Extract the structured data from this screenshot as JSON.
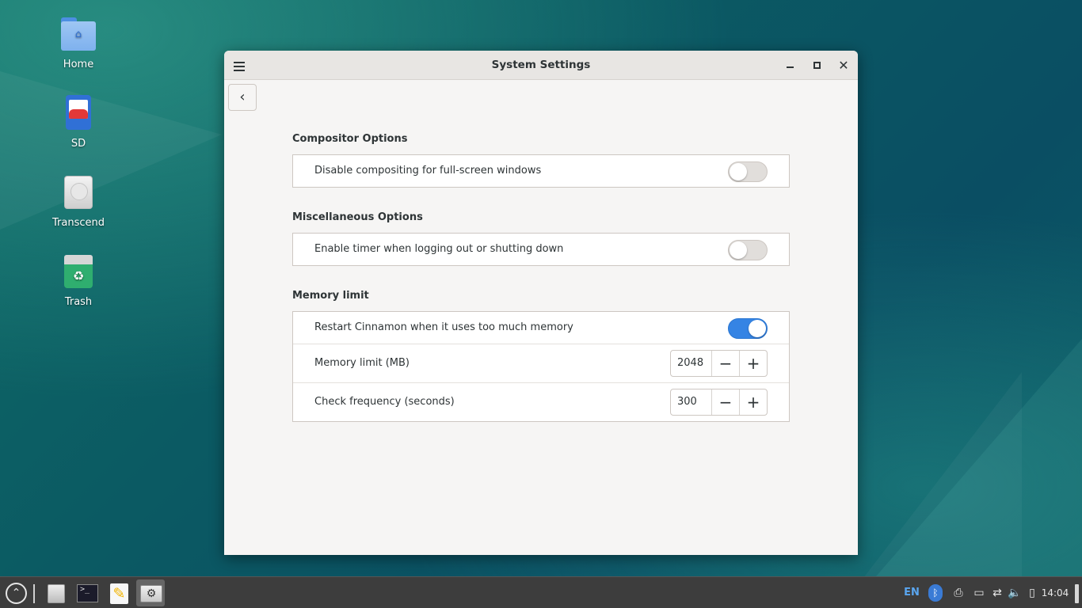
{
  "desktop": {
    "icons": [
      {
        "label": "Home",
        "icon": "home-folder-icon"
      },
      {
        "label": "SD",
        "icon": "sd-card-icon"
      },
      {
        "label": "Transcend",
        "icon": "hard-drive-icon"
      },
      {
        "label": "Trash",
        "icon": "trash-icon"
      }
    ]
  },
  "window": {
    "title": "System Settings",
    "sections": [
      {
        "title": "Compositor Options",
        "rows": [
          {
            "label": "Disable compositing for full-screen windows",
            "control": "switch",
            "enabled": false
          }
        ]
      },
      {
        "title": "Miscellaneous Options",
        "rows": [
          {
            "label": "Enable timer when logging out or shutting down",
            "control": "switch",
            "enabled": false
          }
        ]
      },
      {
        "title": "Memory limit",
        "rows": [
          {
            "label": "Restart Cinnamon when it uses too much memory",
            "control": "switch",
            "enabled": true
          },
          {
            "label": "Memory limit (MB)",
            "control": "spin",
            "value": "2048"
          },
          {
            "label": "Check frequency (seconds)",
            "control": "spin",
            "value": "300"
          }
        ]
      }
    ]
  },
  "taskbar": {
    "apps": [
      {
        "name": "menu-icon"
      },
      {
        "name": "file-manager-icon"
      },
      {
        "name": "terminal-icon"
      },
      {
        "name": "text-editor-icon"
      },
      {
        "name": "system-settings-icon",
        "active": true
      }
    ],
    "tray": {
      "keyboard_layout": "EN",
      "clock": "14:04"
    }
  },
  "colors": {
    "accent": "#3584e4",
    "window_bg": "#f6f5f4",
    "taskbar_bg": "#3d3d3d"
  }
}
